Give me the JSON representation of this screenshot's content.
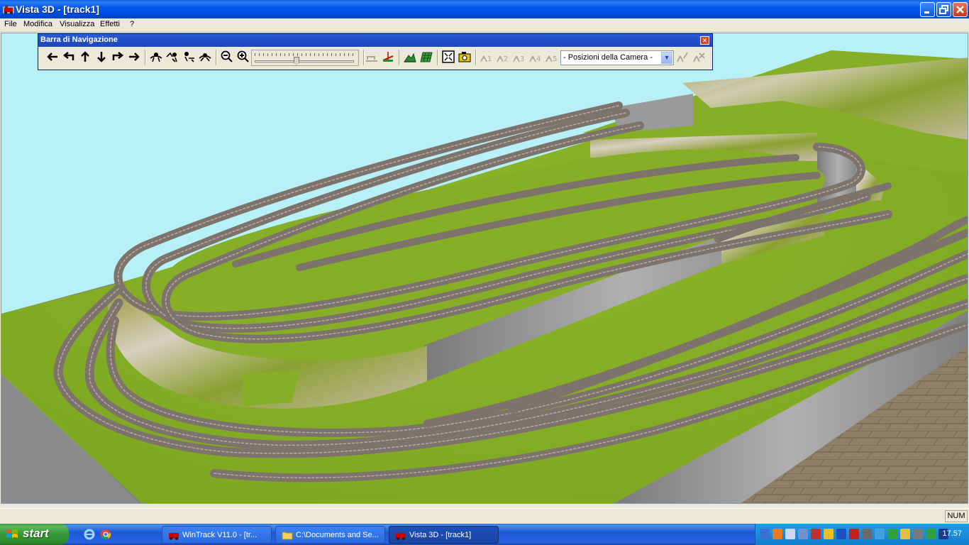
{
  "window": {
    "title": "Vista 3D - [track1]"
  },
  "menu": {
    "items": [
      "File",
      "Modifica",
      "Visualizza",
      "Effetti",
      "?"
    ]
  },
  "navbar": {
    "title": "Barra di Navigazione",
    "camera_select_value": "- Posizioni della Camera -",
    "icons": [
      "arrow-left-icon",
      "rotate-left-icon",
      "arrow-up-icon",
      "arrow-down-icon",
      "rotate-right-icon",
      "arrow-right-icon",
      "orbit-icon",
      "tilt-up-icon",
      "tilt-down-icon",
      "orbit-reset-icon",
      "zoom-out-icon",
      "zoom-in-icon",
      "terrain-icon",
      "measure-icon",
      "landscape-icon",
      "grid-icon",
      "fit-view-icon",
      "camera-icon",
      "camera-1-icon",
      "camera-2-icon",
      "camera-3-icon",
      "camera-4-icon",
      "camera-5-icon",
      "camera-edit-icon",
      "camera-delete-icon"
    ]
  },
  "status": {
    "num": "NUM"
  },
  "taskbar": {
    "start_label": "start",
    "tasks": [
      {
        "label": "WinTrack  V11.0 - [tr..."
      },
      {
        "label": "C:\\Documents and Se..."
      },
      {
        "label": "Vista 3D - [track1]"
      }
    ],
    "clock": "17.57"
  },
  "colors": {
    "sky": "#B7F0F6",
    "grass": "#8CB52A",
    "rail": "#8A7F78",
    "wall": "#9C9C9C",
    "floor": "#8E7F66"
  }
}
